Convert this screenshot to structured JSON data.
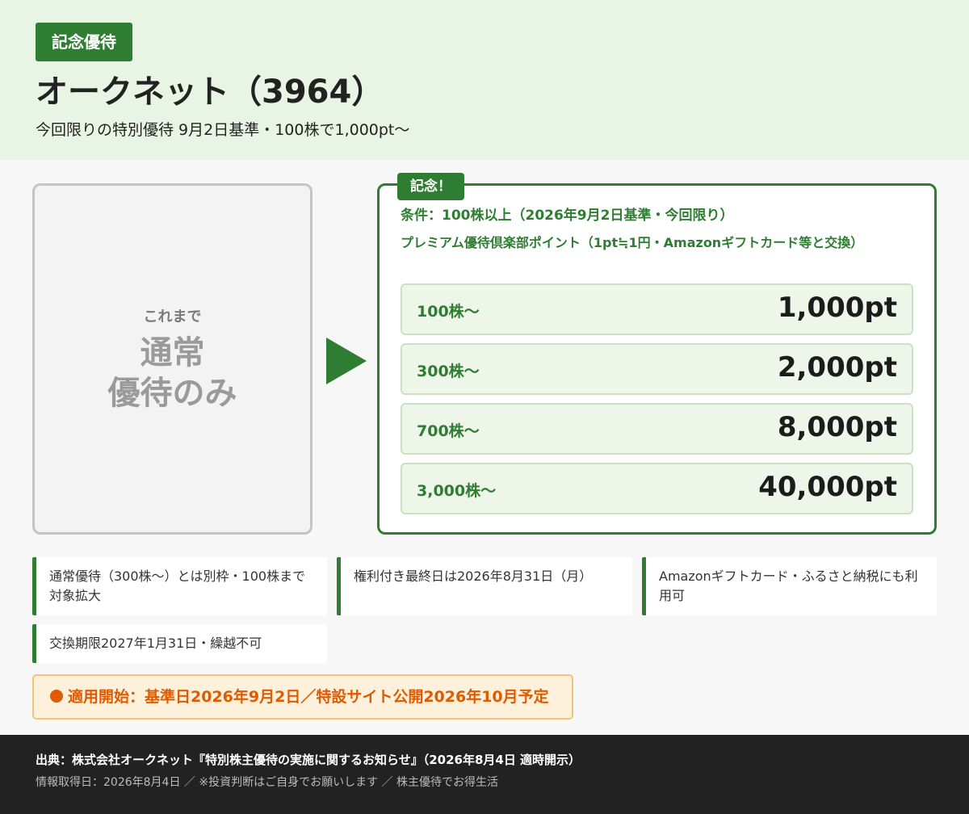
{
  "header": {
    "badge": "記念優待",
    "title": "オークネット（3964）",
    "subtitle": "今回限りの特別優待 9月2日基準・100株で1,000pt〜"
  },
  "before": {
    "small": "これまで",
    "big_line1": "通常",
    "big_line2": "優待のみ"
  },
  "arrow_icon": "right-triangle-arrow",
  "new": {
    "tag": "記念！",
    "condition": "条件：100株以上（2026年9月2日基準・今回限り）",
    "description": "プレミアム優待倶楽部ポイント（1pt≒1円・Amazonギフトカード等と交換）",
    "tiers": [
      {
        "label": "100株〜",
        "value": "1,000pt"
      },
      {
        "label": "300株〜",
        "value": "2,000pt"
      },
      {
        "label": "700株〜",
        "value": "8,000pt"
      },
      {
        "label": "3,000株〜",
        "value": "40,000pt"
      }
    ]
  },
  "notes": [
    "通常優待（300株〜）とは別枠・100株まで対象拡大",
    "権利付き最終日は2026年8月31日（月）",
    "Amazonギフトカード・ふるさと納税にも利用可",
    "交換期限2027年1月31日・繰越不可"
  ],
  "alert": "適用開始：基準日2026年9月2日／特設サイト公開2026年10月予定",
  "footer": {
    "source": "出典：株式会社オークネット『特別株主優待の実施に関するお知らせ』（2026年8月4日 適時開示）",
    "meta": "情報取得日：2026年8月4日 ／ ※投資判断はご自身でお願いします ／ 株主優待でお得生活"
  },
  "colors": {
    "accent": "#2f7d32",
    "header_bg": "#e8f5e5",
    "alert": "#e05a00",
    "footer_bg": "#222222"
  }
}
